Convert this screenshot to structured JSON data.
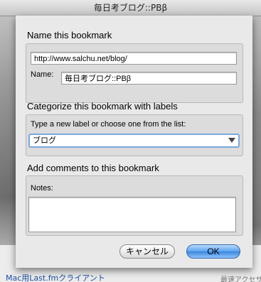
{
  "window": {
    "title": "毎日考ブログ::PBβ"
  },
  "background": {
    "link_text": "Mac用Last.fmクライアント",
    "sub_text": "最速アクセサ"
  },
  "dialog": {
    "name_section": {
      "title": "Name this bookmark",
      "url_value": "http://www.salchu.net/blog/",
      "name_label": "Name:",
      "name_value": "毎日考ブログ::PBβ"
    },
    "label_section": {
      "title": "Categorize this bookmark with labels",
      "instruction": "Type a new label or choose one from the list:",
      "label_value": "ブログ"
    },
    "comment_section": {
      "title": "Add comments to this bookmark",
      "notes_label": "Notes:",
      "notes_value": ""
    },
    "buttons": {
      "cancel": "キャンセル",
      "ok": "OK"
    }
  }
}
